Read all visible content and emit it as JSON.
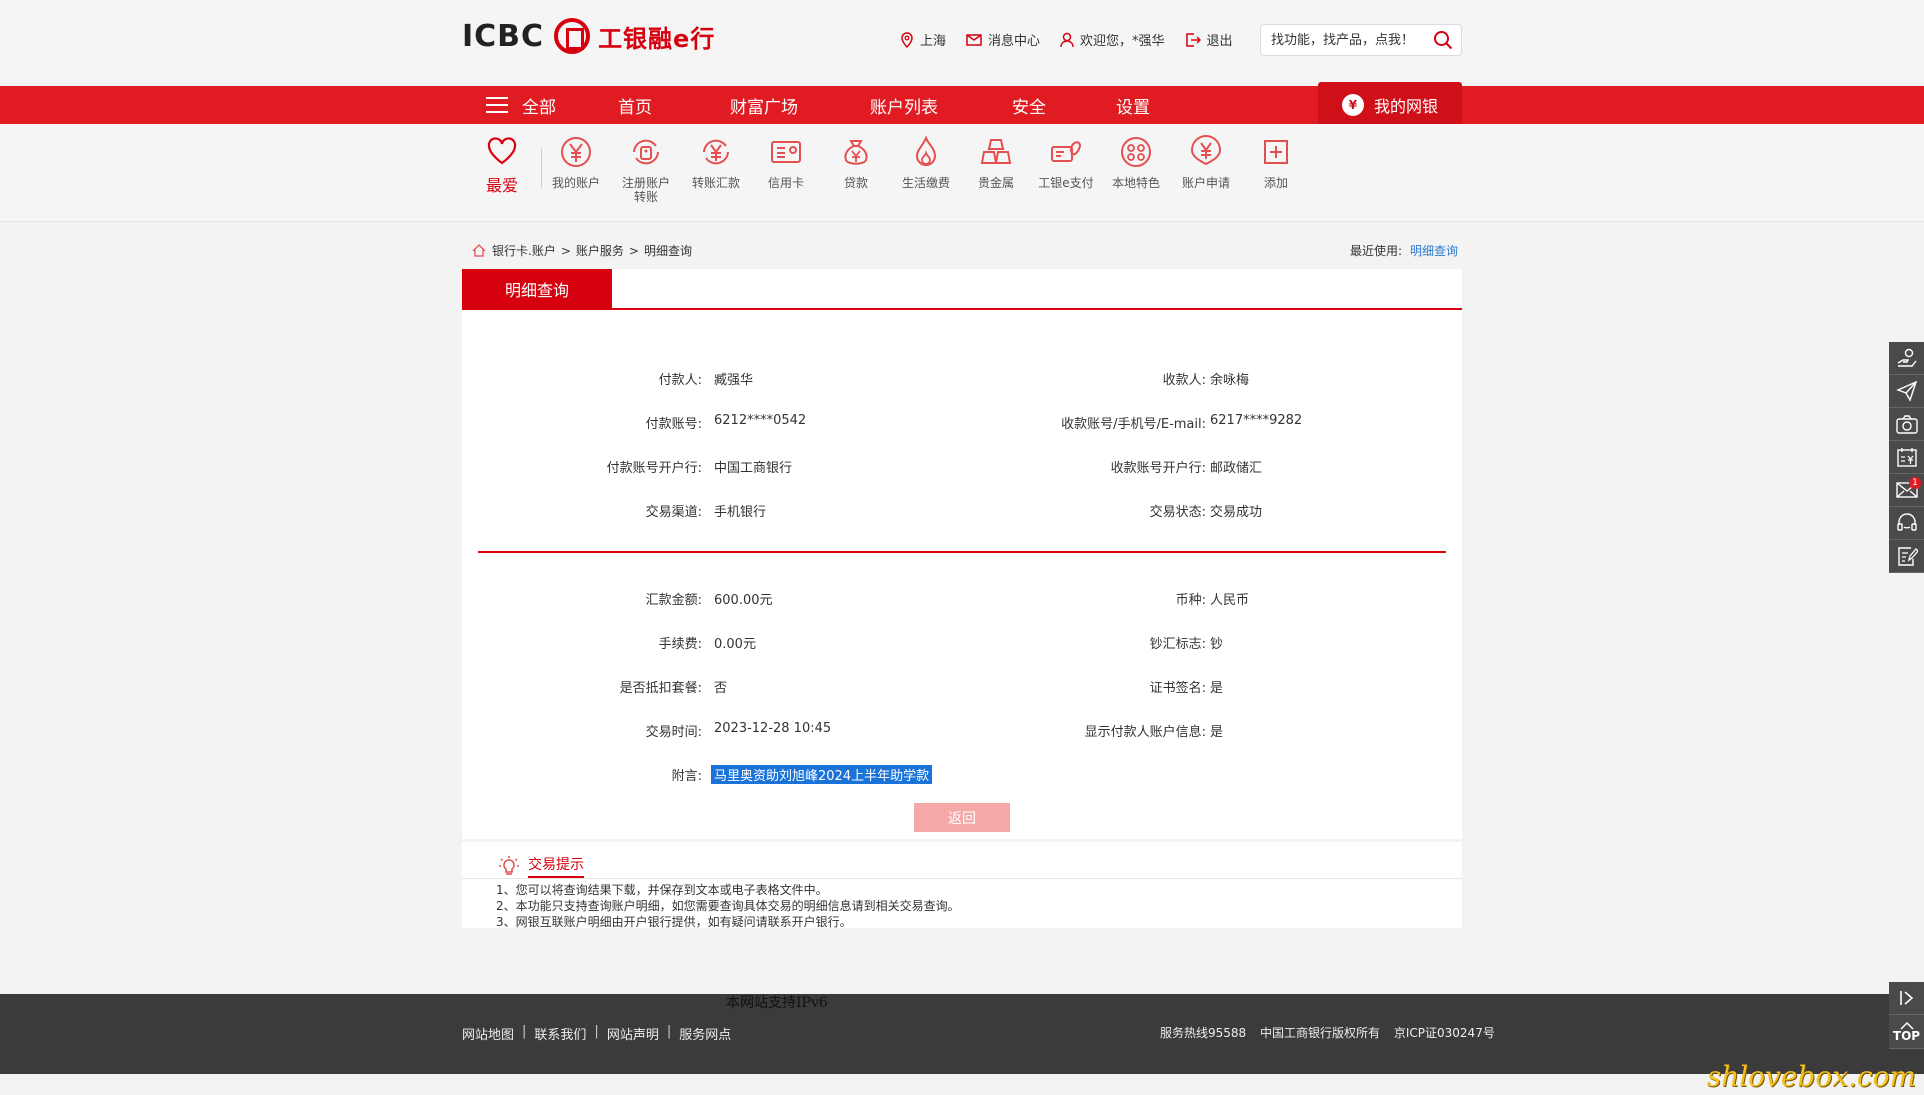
{
  "header": {
    "logo_en": "ICBC",
    "logo_cn": "工银融e行",
    "location": "上海",
    "messages": "消息中心",
    "welcome": "欢迎您，*强华",
    "logout": "退出",
    "search_placeholder": "找功能，找产品，点我！"
  },
  "nav": {
    "all": "全部",
    "items": [
      "首页",
      "财富广场",
      "账户列表",
      "安全",
      "设置"
    ],
    "mybank": "我的网银"
  },
  "quick": {
    "favorite": "最爱",
    "items": [
      {
        "label": "我的账户",
        "icon": "yuan-icon"
      },
      {
        "label": "注册账户转账",
        "icon": "registered-transfer-icon"
      },
      {
        "label": "转账汇款",
        "icon": "transfer-icon"
      },
      {
        "label": "信用卡",
        "icon": "credit-card-icon"
      },
      {
        "label": "贷款",
        "icon": "money-bag-icon"
      },
      {
        "label": "生活缴费",
        "icon": "flame-icon"
      },
      {
        "label": "贵金属",
        "icon": "gold-bars-icon"
      },
      {
        "label": "工银e支付",
        "icon": "epay-icon"
      },
      {
        "label": "本地特色",
        "icon": "local-icon"
      },
      {
        "label": "账户申请",
        "icon": "account-apply-icon"
      },
      {
        "label": "添加",
        "icon": "plus-icon"
      }
    ]
  },
  "breadcrumb": [
    "银行卡.账户",
    ">",
    "账户服务",
    ">",
    "明细查询"
  ],
  "recent": {
    "label": "最近使用:",
    "link": "明细查询"
  },
  "tab": "明细查询",
  "details_top": [
    {
      "l_label": "付款人:",
      "l_value": "臧强华",
      "r_label": "收款人:",
      "r_value": "余咏梅"
    },
    {
      "l_label": "付款账号:",
      "l_value": "6212****0542",
      "r_label": "收款账号/手机号/E-mail:",
      "r_value": "6217****9282"
    },
    {
      "l_label": "付款账号开户行:",
      "l_value": "中国工商银行",
      "r_label": "收款账号开户行:",
      "r_value": "邮政储汇"
    },
    {
      "l_label": "交易渠道:",
      "l_value": "手机银行",
      "r_label": "交易状态:",
      "r_value": "交易成功"
    }
  ],
  "details_bottom": [
    {
      "l_label": "汇款金额:",
      "l_value": "600.00元",
      "r_label": "币种:",
      "r_value": "人民币"
    },
    {
      "l_label": "手续费:",
      "l_value": "0.00元",
      "r_label": "钞汇标志:",
      "r_value": "钞"
    },
    {
      "l_label": "是否抵扣套餐:",
      "l_value": "否",
      "r_label": "证书签名:",
      "r_value": "是"
    },
    {
      "l_label": "交易时间:",
      "l_value": "2023-12-28 10:45",
      "r_label": "显示付款人账户信息:",
      "r_value": "是"
    }
  ],
  "memo": {
    "label": "附言:",
    "value": "马里奥资助刘旭峰2024上半年助学款"
  },
  "back_button": "返回",
  "tips": {
    "title": "交易提示",
    "lines": [
      "1、您可以将查询结果下载，并保存到文本或电子表格文件中。",
      "2、本功能只支持查询账户明细，如您需要查询具体交易的明细信息请到相关交易查询。",
      "3、网银互联账户明细由开户银行提供，如有疑问请联系开户银行。"
    ]
  },
  "footer": {
    "ipv6": "本网站支持IPv6",
    "links": [
      "网站地图",
      "联系我们",
      "网站声明",
      "服务网点"
    ],
    "hotline": "服务热线95588",
    "copyright": "中国工商银行版权所有",
    "icp": "京ICP证030247号"
  },
  "side": {
    "badge": "1",
    "top": "TOP"
  },
  "watermark": "shlovebox.com",
  "colors": {
    "brand_red": "#d7000f",
    "nav_red": "#e11b22",
    "link_blue": "#2b7bd1"
  }
}
